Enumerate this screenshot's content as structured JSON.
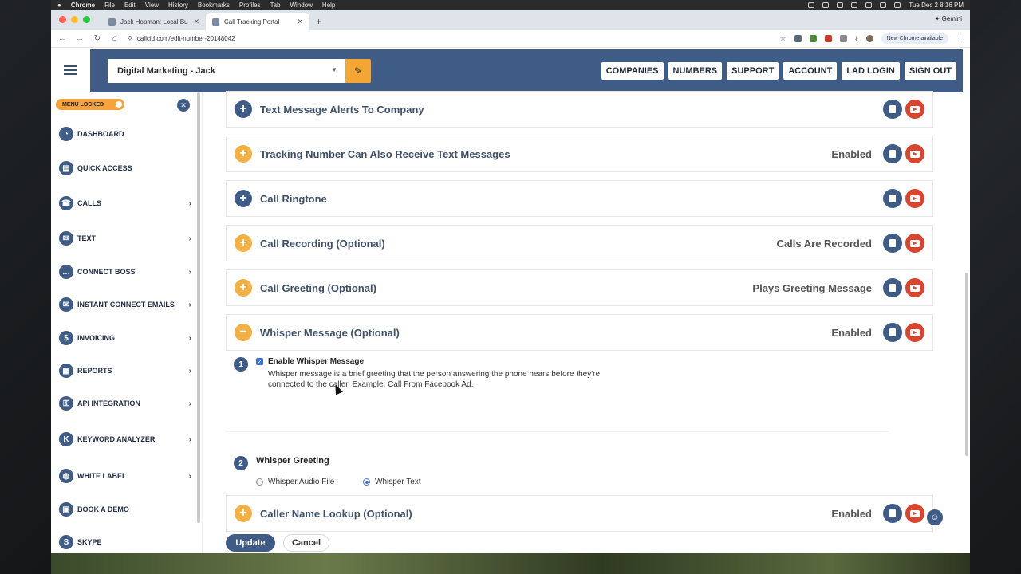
{
  "macbar": {
    "apple": "",
    "app": "Chrome",
    "menus": [
      "File",
      "Edit",
      "View",
      "History",
      "Bookmarks",
      "Profiles",
      "Tab",
      "Window",
      "Help"
    ],
    "datetime": "Tue Dec 2  8:16 PM"
  },
  "browser": {
    "tabs": [
      {
        "title": "Jack Hopman: Local Business"
      },
      {
        "title": "Call Tracking Portal"
      }
    ],
    "gemini": "Gemini",
    "url": "callcid.com/edit-number-20148042",
    "new_chrome": "New Chrome available"
  },
  "header": {
    "company": "Digital Marketing - Jack",
    "nav": [
      "COMPANIES",
      "NUMBERS",
      "SUPPORT",
      "ACCOUNT",
      "LAD LOGIN",
      "SIGN OUT"
    ]
  },
  "sidebar": {
    "menu_locked": "MENU LOCKED",
    "items": [
      {
        "label": "DASHBOARD",
        "icon": "dashboard-icon",
        "arrow": false
      },
      {
        "label": "QUICK ACCESS",
        "icon": "quick-access-icon",
        "arrow": false
      },
      {
        "label": "CALLS",
        "icon": "phone-icon",
        "arrow": true
      },
      {
        "label": "TEXT",
        "icon": "chat-icon",
        "arrow": true
      },
      {
        "label": "CONNECT BOSS",
        "icon": "connect-icon",
        "arrow": true
      },
      {
        "label": "INSTANT CONNECT EMAILS",
        "icon": "email-icon",
        "arrow": true
      },
      {
        "label": "INVOICING",
        "icon": "invoice-icon",
        "arrow": true
      },
      {
        "label": "REPORTS",
        "icon": "reports-icon",
        "arrow": true
      },
      {
        "label": "API INTEGRATION",
        "icon": "key-icon",
        "arrow": true
      },
      {
        "label": "KEYWORD ANALYZER",
        "icon": "keyword-icon",
        "arrow": true
      },
      {
        "label": "WHITE LABEL",
        "icon": "globe-icon",
        "arrow": true
      },
      {
        "label": "BOOK A DEMO",
        "icon": "demo-icon",
        "arrow": false
      },
      {
        "label": "SKYPE",
        "icon": "skype-icon",
        "arrow": false
      }
    ]
  },
  "sections": [
    {
      "title": "Text Message Alerts To Company",
      "status": "",
      "color": "blue",
      "sign": "+"
    },
    {
      "title": "Tracking Number Can Also Receive Text Messages",
      "status": "Enabled",
      "color": "orange",
      "sign": "+"
    },
    {
      "title": "Call Ringtone",
      "status": "",
      "color": "blue",
      "sign": "+"
    },
    {
      "title": "Call Recording (Optional)",
      "status": "Calls Are Recorded",
      "color": "orange",
      "sign": "+"
    },
    {
      "title": "Call Greeting (Optional)",
      "status": "Plays Greeting Message",
      "color": "orange",
      "sign": "+"
    },
    {
      "title": "Whisper Message (Optional)",
      "status": "Enabled",
      "color": "orange",
      "sign": "−"
    }
  ],
  "whisper": {
    "step1_num": "1",
    "enable_label": "Enable Whisper Message",
    "enable_checked": true,
    "description": "Whisper message is a brief greeting that the person answering the phone hears before they're connected to the caller. Example: Call From Facebook Ad.",
    "step2_num": "2",
    "greeting_title": "Whisper Greeting",
    "options": [
      "Whisper Audio File",
      "Whisper Text"
    ],
    "selected_option": "Whisper Text"
  },
  "caller_lookup": {
    "title": "Caller Name Lookup (Optional)",
    "status": "Enabled",
    "sign": "+"
  },
  "buttons": {
    "update": "Update",
    "cancel": "Cancel"
  },
  "colors": {
    "brand_blue": "#3f5c87",
    "accent_orange": "#f3a634",
    "youtube_red": "#d9452e"
  }
}
